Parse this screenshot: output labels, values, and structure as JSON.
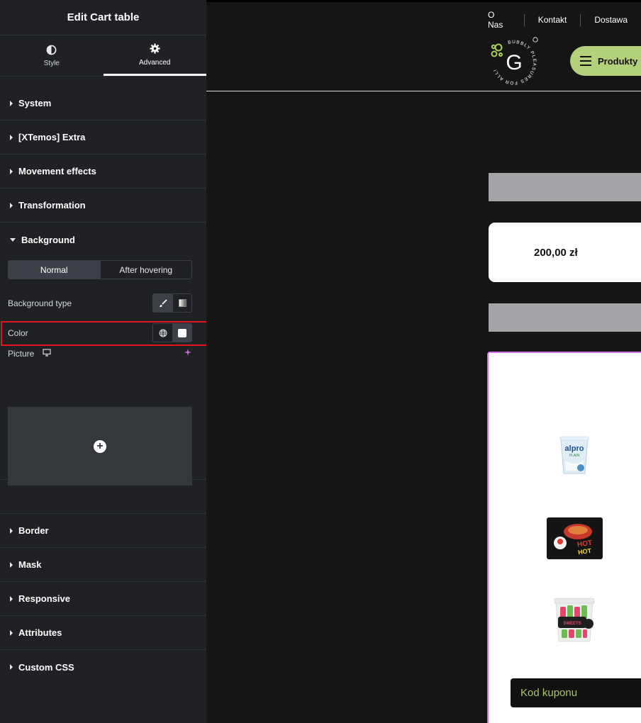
{
  "panel": {
    "title": "Edit Cart table",
    "tabs": [
      {
        "label": "Style",
        "icon": "half-circle-icon",
        "active": false
      },
      {
        "label": "Advanced",
        "icon": "gear-icon",
        "active": true
      }
    ],
    "sections_top": [
      "System",
      "[XTemos] Extra",
      "Movement effects",
      "Transformation"
    ],
    "background": {
      "label": "Background",
      "state_tabs": [
        "Normal",
        "After hovering"
      ],
      "active_state": "Normal",
      "type_label": "Background type",
      "color_label": "Color",
      "picture_label": "Picture",
      "color_value": "#ffffff"
    },
    "sections_bottom": [
      "Border",
      "Mask",
      "Responsive",
      "Attributes",
      "Custom CSS"
    ]
  },
  "preview": {
    "nav_links": [
      "O Nas",
      "Kontakt",
      "Dostawa"
    ],
    "menu_label": "Produkty",
    "logo_letter": "G",
    "logo_ring_text": "BUBBLY PLEASURES FOR ALL!",
    "price": "200,00 zł",
    "coupon_placeholder": "Kod kuponu",
    "accent": "#b3d17a"
  }
}
